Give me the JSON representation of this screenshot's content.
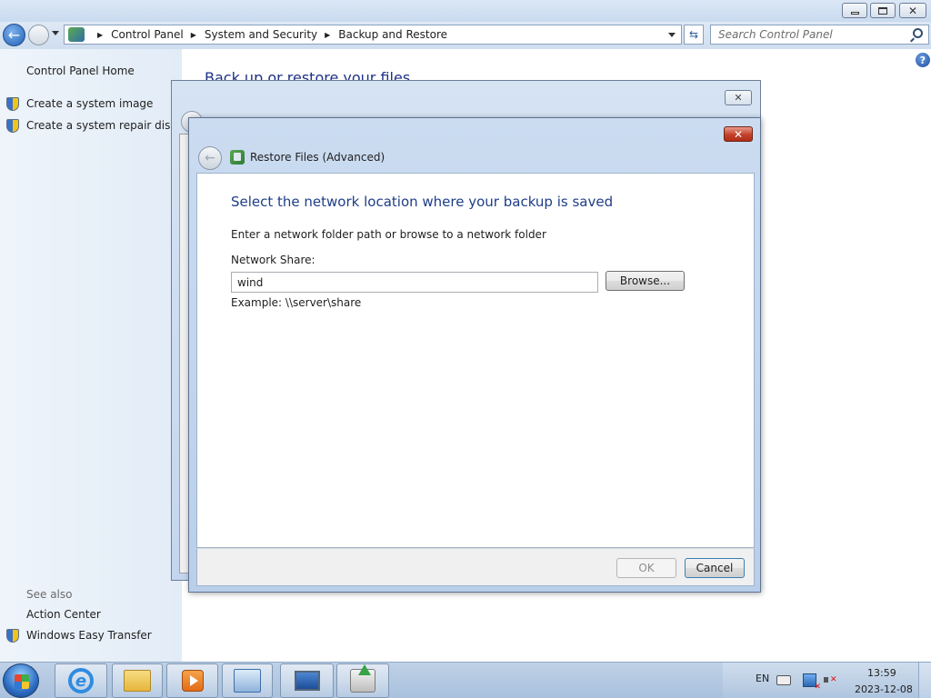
{
  "explorer": {
    "breadcrumb": [
      "Control Panel",
      "System and Security",
      "Backup and Restore"
    ],
    "search_placeholder": "Search Control Panel",
    "background_heading": "Back up or restore your files"
  },
  "sidebar": {
    "home": "Control Panel Home",
    "tasks": [
      "Create a system image",
      "Create a system repair disc"
    ],
    "see_also_title": "See also",
    "see_also": [
      "Action Center",
      "Windows Easy Transfer"
    ]
  },
  "dialog": {
    "title": "Restore Files (Advanced)",
    "heading": "Select the network location where your backup is saved",
    "instruction": "Enter a network folder path or browse to a network folder",
    "network_share_label": "Network Share:",
    "network_share_value": "wind",
    "browse_label": "Browse...",
    "example": "Example: \\\\server\\share",
    "ok_label": "OK",
    "cancel_label": "Cancel"
  },
  "taskbar": {
    "language": "EN",
    "time": "13:59",
    "date": "2023-12-08",
    "apps": [
      "internet-explorer-icon",
      "windows-explorer-icon",
      "media-player-icon",
      "control-panel-icon",
      "remote-desktop-icon",
      "backup-restore-icon"
    ]
  },
  "colors": {
    "heading_blue": "#1e3e87",
    "close_red": "#c4412a",
    "taskbar": "#a9c1dd"
  }
}
